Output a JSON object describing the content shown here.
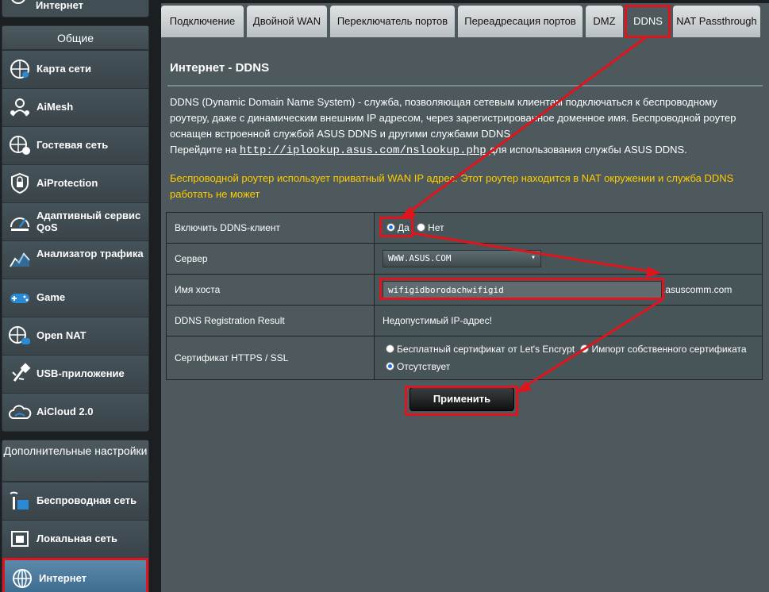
{
  "sidebar": {
    "top_item": {
      "label": "Интернет",
      "icon": "globe-icon"
    },
    "general_header": "Общие",
    "general_items": [
      {
        "label": "Карта сети",
        "icon": "network-map-icon"
      },
      {
        "label": "AiMesh",
        "icon": "aimesh-icon"
      },
      {
        "label": "Гостевая сеть",
        "icon": "guest-network-icon"
      },
      {
        "label": "AiProtection",
        "icon": "lock-shield-icon"
      },
      {
        "label": "Адаптивный сервис QoS",
        "icon": "qos-gauge-icon"
      },
      {
        "label": "Анализатор трафика",
        "icon": "traffic-analyzer-icon"
      },
      {
        "label": "Game",
        "icon": "gamepad-icon"
      },
      {
        "label": "Open NAT",
        "icon": "open-nat-icon"
      },
      {
        "label": "USB-приложение",
        "icon": "usb-icon"
      },
      {
        "label": "AiCloud 2.0",
        "icon": "cloud-icon"
      }
    ],
    "advanced_header": "Дополнительные настройки",
    "advanced_items": [
      {
        "label": "Беспроводная сеть",
        "icon": "wireless-icon"
      },
      {
        "label": "Локальная сеть",
        "icon": "lan-icon"
      },
      {
        "label": "Интернет",
        "icon": "globe-icon"
      }
    ]
  },
  "tabs": [
    "Подключение",
    "Двойной WAN",
    "Переключатель портов",
    "Переадресация портов",
    "DMZ",
    "DDNS",
    "NAT Passthrough"
  ],
  "active_tab": "DDNS",
  "page": {
    "title": "Интернет - DDNS",
    "desc_line1": "DDNS (Dynamic Domain Name System) - служба, позволяющая сетевым клиентам подключаться к беспроводному",
    "desc_line2": "роутеру, даже с динамическим внешним IP адресом, через зарегистрированное доменное имя. Беспроводной роутер",
    "desc_line3": "оснащен встроенной службой ASUS DDNS и другими службами DDNS.",
    "desc_link_prefix": "Перейдите на ",
    "desc_link": "http://iplookup.asus.com/nslookup.php",
    "desc_link_suffix": " для использования службы ASUS DDNS.",
    "warning": "Беспроводной роутер использует приватный WAN IP адрес. Этот роутер находится в NAT окружении и служба DDNS работать не может"
  },
  "form": {
    "enable_label": "Включить DDNS-клиент",
    "enable_yes": "Да",
    "enable_no": "Нет",
    "server_label": "Сервер",
    "server_value": "WWW.ASUS.COM",
    "host_label": "Имя хоста",
    "host_value": "wifigidborodachwifigid",
    "host_suffix": ".asuscomm.com",
    "result_label": "DDNS Registration Result",
    "result_value": "Недопустимый IP-адрес!",
    "cert_label": "Сертификат HTTPS / SSL",
    "cert_opt1": "Бесплатный сертификат от Let's Encrypt",
    "cert_opt2": "Импорт собственного сертификата",
    "cert_opt3": "Отсутствует"
  },
  "apply_label": "Применить",
  "colors": {
    "highlight": "#e0141c",
    "warning": "#ffcc00",
    "panel": "#4d595d"
  }
}
